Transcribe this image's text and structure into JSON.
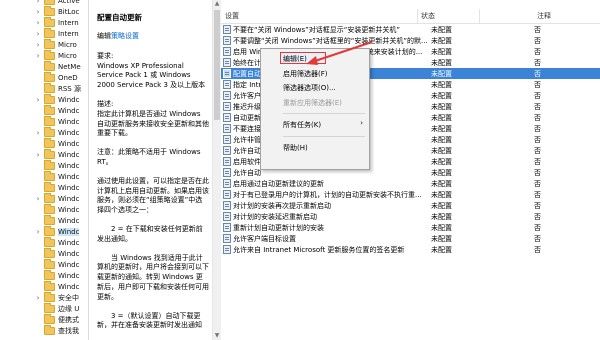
{
  "tree": {
    "items": [
      {
        "label": "Active",
        "chev": "›"
      },
      {
        "label": "BitLoc",
        "chev": "›"
      },
      {
        "label": "Intern",
        "chev": "›"
      },
      {
        "label": "Intern",
        "chev": "›"
      },
      {
        "label": "Micro",
        "chev": "›"
      },
      {
        "label": "Micro",
        "chev": "›"
      },
      {
        "label": "NetMe",
        "chev": ""
      },
      {
        "label": "OneD",
        "chev": ""
      },
      {
        "label": "RSS 源",
        "chev": ""
      },
      {
        "label": "Windc",
        "chev": "›"
      },
      {
        "label": "Windc",
        "chev": ""
      },
      {
        "label": "Windc",
        "chev": ""
      },
      {
        "label": "Windc",
        "chev": "›"
      },
      {
        "label": "Windc",
        "chev": ""
      },
      {
        "label": "Windc",
        "chev": "›"
      },
      {
        "label": "Windc",
        "chev": ""
      },
      {
        "label": "Windc",
        "chev": ""
      },
      {
        "label": "Windc",
        "chev": ""
      },
      {
        "label": "Windc",
        "chev": "›"
      },
      {
        "label": "Windc",
        "chev": ""
      },
      {
        "label": "Windc",
        "chev": ""
      },
      {
        "label": "Windc",
        "chev": "›"
      },
      {
        "label": "Windc",
        "chev": ""
      },
      {
        "label": "Windc",
        "chev": ""
      },
      {
        "label": "Windc",
        "chev": ""
      },
      {
        "label": "Windc",
        "chev": ""
      },
      {
        "label": "Windc",
        "chev": ""
      },
      {
        "label": "安全中",
        "chev": "›"
      },
      {
        "label": "边缘 U",
        "chev": ""
      },
      {
        "label": "便携式",
        "chev": ""
      },
      {
        "label": "查找我",
        "chev": ""
      }
    ],
    "selected_index": 21
  },
  "desc": {
    "title": "配置自动更新",
    "edit_prefix": "编辑",
    "edit_link": "策略设置",
    "requirements_label": "要求:",
    "requirements": "Windows XP Professional Service Pack 1 或 Windows 2000 Service Pack 3 及以上版本",
    "description_label": "描述:",
    "description": "指定此计算机是否通过 Windows 自动更新服务来接收安全更新和其他重要下载。",
    "note": "注意：此策略不适用于 Windows RT。",
    "p1": "通过使用此设置，可以指定是否在此计算机上启用自动更新。如果启用该服务，则必须在“组策略设置”中选择四个选项之一：",
    "p2": "2 = 在下载和安装任何更新前发出通知。",
    "p3": "当 Windows 找到适用于此计算机的更新时，用户将会接到可以下载更新的通知。转到 Windows 更新后，用户即可下载和安装任何可用更新。",
    "p4": "3 =（默认设置）自动下载更新，并在准备安装更新时发出通知"
  },
  "table": {
    "headers": {
      "setting": "设置",
      "state": "状态",
      "note": "注释"
    },
    "rows": [
      {
        "name": "不要在“关闭 Windows”对话框显示“安装更新并关机”",
        "state": "未配置",
        "note": "否"
      },
      {
        "name": "不要调整“关闭 Windows”对话框里的“安装更新并关机”的默...",
        "state": "未配置",
        "note": "否"
      },
      {
        "name": "启用 Windows 更新电源管理以自动唤醒系统来安装计划的...",
        "state": "未配置",
        "note": "否"
      },
      {
        "name": "始终在计划的时间重新启动",
        "state": "未配置",
        "note": "否"
      },
      {
        "name": "配置自动更新",
        "state": "未配置",
        "note": "否"
      },
      {
        "name": "指定 Intr",
        "state": "未配置",
        "note": "否"
      },
      {
        "name": "允许客户",
        "state": "未配置",
        "note": "否"
      },
      {
        "name": "推迟升级",
        "state": "未配置",
        "note": "否"
      },
      {
        "name": "自动更新",
        "state": "未配置",
        "note": "否"
      },
      {
        "name": "不要连接",
        "state": "未配置",
        "note": "否"
      },
      {
        "name": "允许非管",
        "state": "未配置",
        "note": "否"
      },
      {
        "name": "允许自动",
        "state": "未配置",
        "note": "否"
      },
      {
        "name": "启用软件",
        "state": "未配置",
        "note": "否"
      },
      {
        "name": "允许自动",
        "state": "未配置",
        "note": "否"
      },
      {
        "name": "启用通过自动更新建议的更新",
        "state": "未配置",
        "note": "否"
      },
      {
        "name": "对于有已登录用户的计算机，计划的自动更新安装不执行重...",
        "state": "未配置",
        "note": "否"
      },
      {
        "name": "对计划的安装再次提示重新启动",
        "state": "未配置",
        "note": "否"
      },
      {
        "name": "对计划的安装延迟重新启动",
        "state": "未配置",
        "note": "否"
      },
      {
        "name": "重新计划自动更新计划的安装",
        "state": "未配置",
        "note": "否"
      },
      {
        "name": "允许客户端目标设置",
        "state": "未配置",
        "note": "否"
      },
      {
        "name": "允许来自 Intranet Microsoft 更新服务位置的签名更新",
        "state": "未配置",
        "note": "否"
      }
    ],
    "selected_index": 4
  },
  "context_menu": {
    "items": [
      {
        "label": "编辑(E)",
        "type": "item"
      },
      {
        "label": "启用筛选器(F)",
        "type": "item"
      },
      {
        "label": "筛选器选项(O)...",
        "type": "item"
      },
      {
        "label": "重新应用筛选器(E)",
        "type": "disabled"
      },
      {
        "label": "",
        "type": "separator"
      },
      {
        "label": "所有任务(K)",
        "type": "submenu",
        "arrow": "›"
      },
      {
        "label": "",
        "type": "separator"
      },
      {
        "label": "帮助(H)",
        "type": "item"
      }
    ]
  },
  "colors": {
    "selection": "#3b83d6",
    "annotation": "#e53935",
    "folder": "#f0c65a"
  }
}
